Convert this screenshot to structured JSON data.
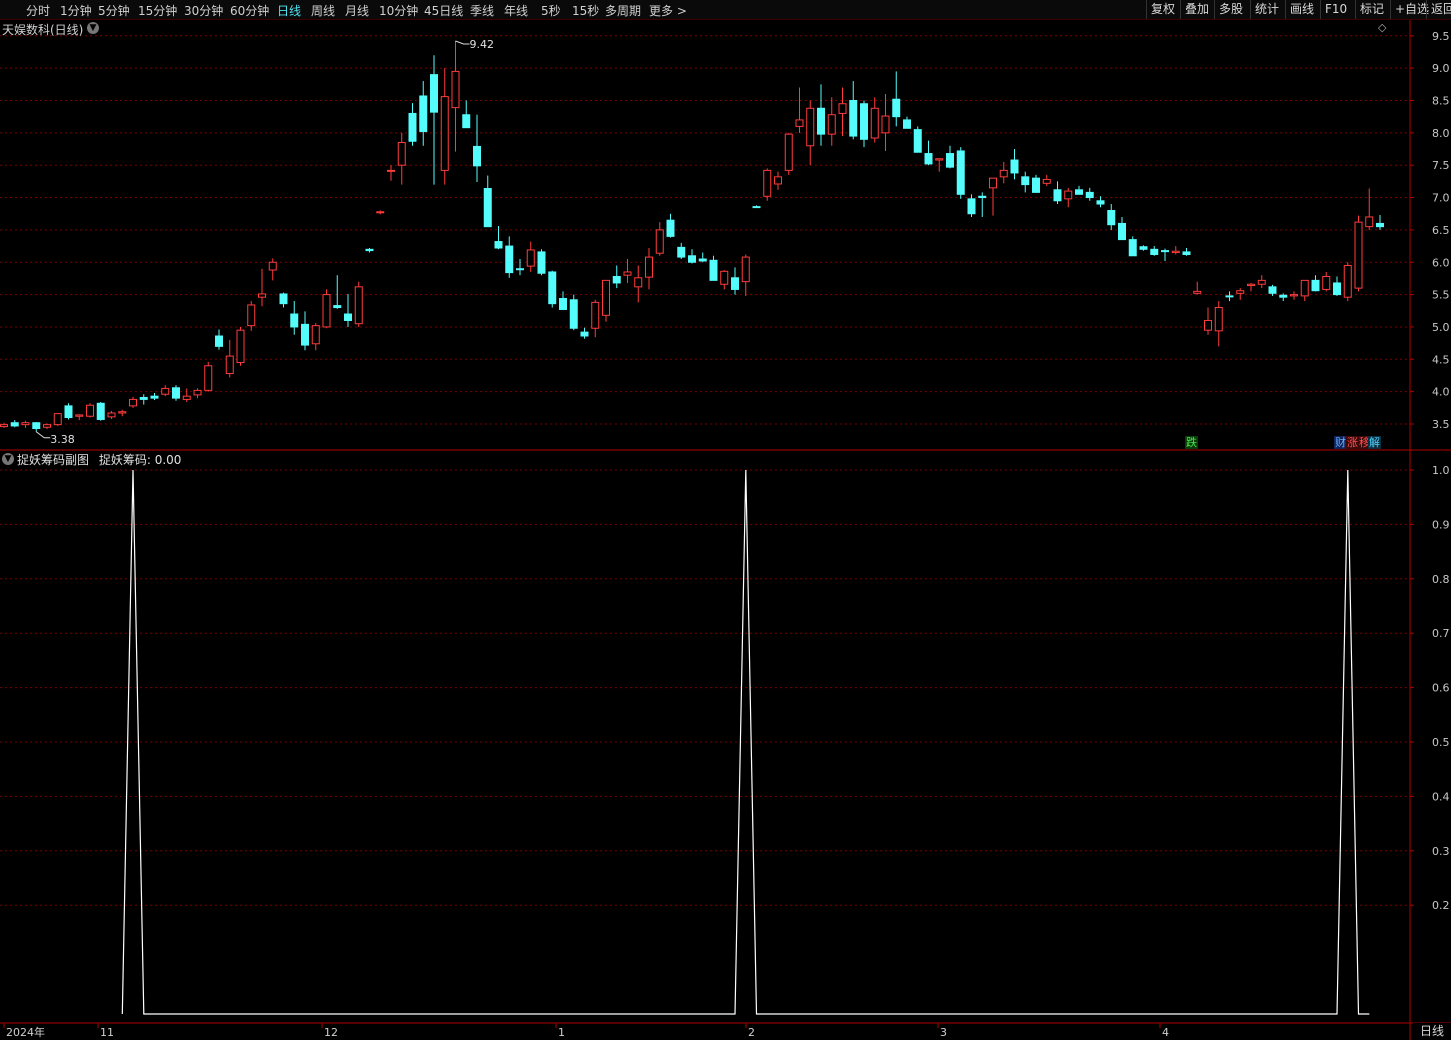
{
  "toolbar": {
    "periods": [
      {
        "label": "分时",
        "active": false
      },
      {
        "label": "1分钟",
        "active": false
      },
      {
        "label": "5分钟",
        "active": false
      },
      {
        "label": "15分钟",
        "active": false
      },
      {
        "label": "30分钟",
        "active": false
      },
      {
        "label": "60分钟",
        "active": false
      },
      {
        "label": "日线",
        "active": true
      },
      {
        "label": "周线",
        "active": false
      },
      {
        "label": "月线",
        "active": false
      },
      {
        "label": "10分钟",
        "active": false
      },
      {
        "label": "45日线",
        "active": false
      },
      {
        "label": "季线",
        "active": false
      },
      {
        "label": "年线",
        "active": false
      },
      {
        "label": "5秒",
        "active": false
      },
      {
        "label": "15秒",
        "active": false
      },
      {
        "label": "多周期",
        "active": false
      },
      {
        "label": "更多 >",
        "active": false
      }
    ],
    "right_buttons": [
      "复权",
      "叠加",
      "多股",
      "统计",
      "画线",
      "F10",
      "标记",
      "+自选",
      "返回"
    ]
  },
  "main_chart": {
    "title": "天娱数科(日线)",
    "y_ticks": [
      "9.5",
      "9.0",
      "8.5",
      "8.0",
      "7.5",
      "7.0",
      "6.5",
      "6.0",
      "5.5",
      "5.0",
      "4.5",
      "4.0",
      "3.5"
    ],
    "max_label": "9.42",
    "min_label": "3.38",
    "event_markers": {
      "die": "跌",
      "cai": "财",
      "zhang": "涨",
      "yi": "移",
      "jie": "解"
    }
  },
  "sub_chart": {
    "title": "捉妖筹码副图",
    "indicator_label": "捉妖筹码: 0.00",
    "y_ticks": [
      "1.0",
      "0.9",
      "0.8",
      "0.7",
      "0.6",
      "0.5",
      "0.4",
      "0.3",
      "0.2"
    ]
  },
  "x_axis": {
    "labels": [
      "2024年",
      "11",
      "12",
      "1",
      "2",
      "3",
      "4"
    ],
    "corner_label": "日线"
  },
  "colors": {
    "up": "#ff3c3c",
    "down": "#54fcfc",
    "grid": "#7a0000",
    "axis": "#b00000",
    "line": "#ffffff"
  },
  "chart_data": [
    {
      "type": "candlestick",
      "title": "天娱数科(日线)",
      "ylim": [
        3.3,
        9.6
      ],
      "fields": [
        "open",
        "high",
        "low",
        "close"
      ],
      "candles": [
        [
          3.46,
          3.52,
          3.44,
          3.49
        ],
        [
          3.52,
          3.56,
          3.45,
          3.47
        ],
        [
          3.49,
          3.55,
          3.44,
          3.52
        ],
        [
          3.52,
          3.53,
          3.38,
          3.43
        ],
        [
          3.45,
          3.51,
          3.42,
          3.49
        ],
        [
          3.49,
          3.67,
          3.47,
          3.66
        ],
        [
          3.78,
          3.82,
          3.57,
          3.6
        ],
        [
          3.62,
          3.65,
          3.56,
          3.64
        ],
        [
          3.62,
          3.82,
          3.6,
          3.79
        ],
        [
          3.82,
          3.84,
          3.55,
          3.57
        ],
        [
          3.61,
          3.7,
          3.58,
          3.67
        ],
        [
          3.67,
          3.72,
          3.62,
          3.69
        ],
        [
          3.78,
          3.92,
          3.75,
          3.88
        ],
        [
          3.91,
          3.96,
          3.8,
          3.88
        ],
        [
          3.93,
          3.98,
          3.87,
          3.9
        ],
        [
          3.96,
          4.1,
          3.93,
          4.05
        ],
        [
          4.06,
          4.1,
          3.86,
          3.9
        ],
        [
          3.88,
          4.05,
          3.84,
          3.93
        ],
        [
          3.95,
          4.05,
          3.9,
          4.02
        ],
        [
          4.02,
          4.46,
          4.0,
          4.4
        ],
        [
          4.86,
          4.96,
          4.65,
          4.7
        ],
        [
          4.28,
          4.8,
          4.22,
          4.55
        ],
        [
          4.45,
          5.0,
          4.4,
          4.95
        ],
        [
          5.02,
          5.4,
          4.94,
          5.34
        ],
        [
          5.46,
          5.9,
          5.32,
          5.51
        ],
        [
          5.88,
          6.06,
          5.72,
          6.0
        ],
        [
          5.51,
          5.53,
          5.3,
          5.36
        ],
        [
          5.2,
          5.4,
          4.88,
          5.0
        ],
        [
          5.04,
          5.24,
          4.64,
          4.72
        ],
        [
          4.74,
          5.06,
          4.64,
          5.02
        ],
        [
          5.0,
          5.58,
          4.98,
          5.5
        ],
        [
          5.33,
          5.8,
          5.28,
          5.3
        ],
        [
          5.2,
          5.51,
          5.0,
          5.1
        ],
        [
          5.05,
          5.7,
          5.0,
          5.62
        ],
        [
          6.2,
          6.22,
          6.15,
          6.18
        ],
        [
          6.77,
          6.8,
          6.74,
          6.78
        ],
        [
          7.42,
          7.5,
          7.26,
          7.42
        ],
        [
          7.5,
          8.0,
          7.2,
          7.85
        ],
        [
          8.3,
          8.46,
          7.8,
          7.87
        ],
        [
          8.57,
          8.8,
          7.8,
          8.02
        ],
        [
          8.9,
          9.2,
          7.2,
          8.32
        ],
        [
          7.42,
          9.0,
          7.2,
          8.56
        ],
        [
          8.39,
          9.42,
          7.71,
          8.95
        ],
        [
          8.28,
          8.5,
          8.1,
          8.08
        ],
        [
          7.79,
          8.28,
          7.24,
          7.49
        ],
        [
          7.14,
          7.34,
          6.6,
          6.55
        ],
        [
          6.32,
          6.56,
          6.2,
          6.22
        ],
        [
          6.25,
          6.4,
          5.76,
          5.84
        ],
        [
          5.9,
          6.05,
          5.8,
          5.89
        ],
        [
          5.94,
          6.32,
          5.85,
          6.19
        ],
        [
          6.16,
          6.2,
          5.8,
          5.83
        ],
        [
          5.85,
          5.87,
          5.3,
          5.36
        ],
        [
          5.44,
          5.55,
          5.26,
          5.27
        ],
        [
          5.42,
          5.5,
          4.95,
          4.98
        ],
        [
          4.92,
          4.99,
          4.82,
          4.86
        ],
        [
          4.98,
          5.42,
          4.84,
          5.38
        ],
        [
          5.18,
          5.72,
          5.08,
          5.72
        ],
        [
          5.78,
          5.95,
          5.6,
          5.68
        ],
        [
          5.8,
          6.05,
          5.68,
          5.85
        ],
        [
          5.62,
          5.95,
          5.38,
          5.76
        ],
        [
          5.77,
          6.22,
          5.58,
          6.08
        ],
        [
          6.14,
          6.62,
          6.1,
          6.5
        ],
        [
          6.65,
          6.75,
          6.38,
          6.4
        ],
        [
          6.23,
          6.3,
          6.05,
          6.08
        ],
        [
          6.1,
          6.2,
          5.98,
          6.0
        ],
        [
          6.05,
          6.15,
          6.0,
          6.02
        ],
        [
          6.03,
          6.1,
          5.82,
          5.72
        ],
        [
          5.66,
          5.88,
          5.58,
          5.86
        ],
        [
          5.76,
          5.92,
          5.5,
          5.58
        ],
        [
          5.7,
          6.12,
          5.48,
          6.08
        ],
        [
          6.86,
          6.88,
          6.84,
          6.85
        ],
        [
          7.02,
          7.45,
          6.95,
          7.42
        ],
        [
          7.21,
          7.4,
          7.12,
          7.32
        ],
        [
          7.42,
          8.0,
          7.35,
          7.98
        ],
        [
          8.1,
          8.7,
          8.0,
          8.2
        ],
        [
          7.8,
          8.5,
          7.5,
          8.38
        ],
        [
          8.38,
          8.75,
          7.8,
          7.98
        ],
        [
          7.98,
          8.55,
          7.8,
          8.28
        ],
        [
          8.3,
          8.7,
          7.95,
          8.45
        ],
        [
          8.5,
          8.8,
          7.9,
          7.95
        ],
        [
          8.45,
          8.5,
          7.78,
          7.9
        ],
        [
          7.92,
          8.55,
          7.85,
          8.38
        ],
        [
          8.0,
          8.6,
          7.72,
          8.26
        ],
        [
          8.52,
          8.95,
          8.1,
          8.25
        ],
        [
          8.2,
          8.25,
          8.1,
          8.07
        ],
        [
          8.05,
          8.1,
          7.75,
          7.7
        ],
        [
          7.68,
          7.88,
          7.5,
          7.52
        ],
        [
          7.58,
          7.6,
          7.4,
          7.6
        ],
        [
          7.68,
          7.8,
          7.45,
          7.47
        ],
        [
          7.72,
          7.78,
          6.98,
          7.05
        ],
        [
          6.98,
          7.05,
          6.7,
          6.75
        ],
        [
          7.02,
          7.08,
          6.7,
          7.0
        ],
        [
          7.15,
          7.3,
          6.72,
          7.3
        ],
        [
          7.32,
          7.55,
          7.22,
          7.42
        ],
        [
          7.58,
          7.75,
          7.28,
          7.38
        ],
        [
          7.32,
          7.4,
          7.08,
          7.2
        ],
        [
          7.3,
          7.35,
          7.1,
          7.08
        ],
        [
          7.22,
          7.35,
          7.18,
          7.28
        ],
        [
          7.12,
          7.25,
          6.9,
          6.95
        ],
        [
          6.98,
          7.15,
          6.85,
          7.1
        ],
        [
          7.12,
          7.18,
          7.05,
          7.05
        ],
        [
          7.08,
          7.15,
          6.95,
          7.0
        ],
        [
          6.95,
          7.02,
          6.85,
          6.9
        ],
        [
          6.8,
          6.9,
          6.5,
          6.58
        ],
        [
          6.6,
          6.7,
          6.35,
          6.35
        ],
        [
          6.35,
          6.4,
          6.12,
          6.1
        ],
        [
          6.24,
          6.26,
          6.18,
          6.2
        ],
        [
          6.2,
          6.25,
          6.1,
          6.12
        ],
        [
          6.18,
          6.21,
          6.02,
          6.17
        ],
        [
          6.15,
          6.25,
          6.12,
          6.17
        ],
        [
          6.16,
          6.22,
          6.1,
          6.12
        ],
        [
          5.52,
          5.7,
          5.5,
          5.55
        ],
        [
          4.95,
          5.3,
          4.88,
          5.1
        ],
        [
          4.94,
          5.4,
          4.7,
          5.3
        ],
        [
          5.48,
          5.55,
          5.4,
          5.47
        ],
        [
          5.52,
          5.6,
          5.42,
          5.56
        ],
        [
          5.64,
          5.68,
          5.55,
          5.66
        ],
        [
          5.66,
          5.8,
          5.6,
          5.72
        ],
        [
          5.62,
          5.65,
          5.48,
          5.52
        ],
        [
          5.49,
          5.52,
          5.4,
          5.46
        ],
        [
          5.48,
          5.55,
          5.42,
          5.5
        ],
        [
          5.48,
          5.7,
          5.4,
          5.72
        ],
        [
          5.72,
          5.8,
          5.55,
          5.56
        ],
        [
          5.58,
          5.85,
          5.55,
          5.78
        ],
        [
          5.68,
          5.78,
          5.48,
          5.5
        ],
        [
          5.46,
          6.0,
          5.4,
          5.95
        ],
        [
          5.6,
          6.72,
          5.55,
          6.62
        ],
        [
          6.55,
          7.14,
          6.5,
          6.7
        ],
        [
          6.6,
          6.73,
          6.5,
          6.55
        ]
      ]
    },
    {
      "type": "line",
      "title": "捉妖筹码副图",
      "name": "捉妖筹码",
      "ylim": [
        0,
        1.0
      ],
      "spikes": [
        {
          "start_bar": 11,
          "peak_bar": 12,
          "end_bar": 13
        },
        {
          "start_bar": 68,
          "peak_bar": 69,
          "end_bar": 70
        },
        {
          "start_bar": 124,
          "peak_bar": 125,
          "end_bar": 126
        }
      ],
      "base_value": 0,
      "peak_value": 1.0,
      "last_bar": 127
    }
  ]
}
